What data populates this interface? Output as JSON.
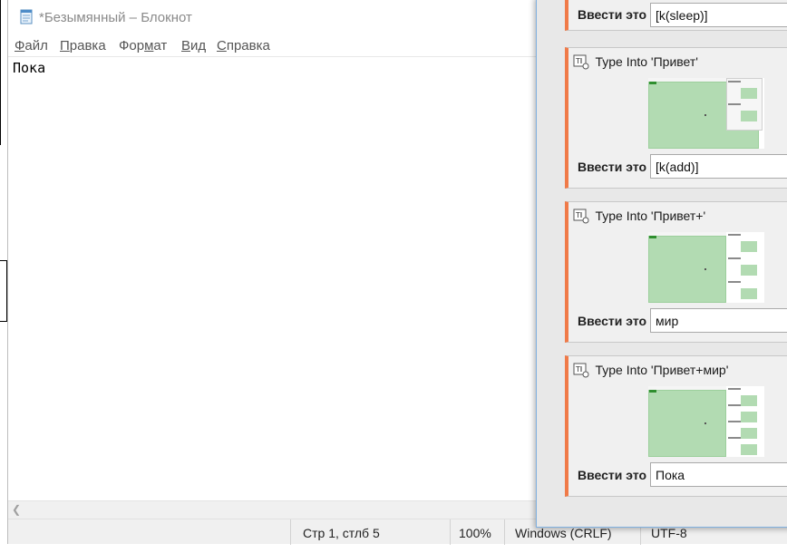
{
  "notepad": {
    "title": "*Безымянный – Блокнот",
    "menu": [
      {
        "pre": "",
        "mn": "Ф",
        "post": "айл"
      },
      {
        "pre": "",
        "mn": "П",
        "post": "равка"
      },
      {
        "pre": "Фор",
        "mn": "м",
        "post": "ат"
      },
      {
        "pre": "",
        "mn": "В",
        "post": "ид"
      },
      {
        "pre": "",
        "mn": "С",
        "post": "правка"
      }
    ],
    "content": "Пока",
    "status": {
      "position": "Стр 1, стлб 5",
      "zoom": "100%",
      "line_endings": "Windows (CRLF)",
      "encoding": "UTF-8"
    },
    "icons": {
      "app": "notepad-icon",
      "scroll_left": "chevron-left-icon"
    }
  },
  "panel": {
    "top_activity": {
      "field_label": "Ввести это",
      "field_value": "[k(sleep)]"
    },
    "activities": [
      {
        "title": "Type Into 'Привет'",
        "field_label": "Ввести это",
        "field_value": "[k(add)]",
        "thumb_variant": "overlay"
      },
      {
        "title": "Type Into 'Привет+'",
        "field_label": "Ввести это",
        "field_value": "мир",
        "thumb_variant": "sidebar"
      },
      {
        "title": "Type Into 'Привет+мир'",
        "field_label": "Ввести это",
        "field_value": "Пока",
        "thumb_variant": "sidebar"
      }
    ],
    "icons": {
      "activity": "type-into-icon"
    },
    "colors": {
      "accent": "#f07a48",
      "thumbnail_green": "#b2dbb2",
      "panel_border": "#7fb0e0"
    }
  }
}
